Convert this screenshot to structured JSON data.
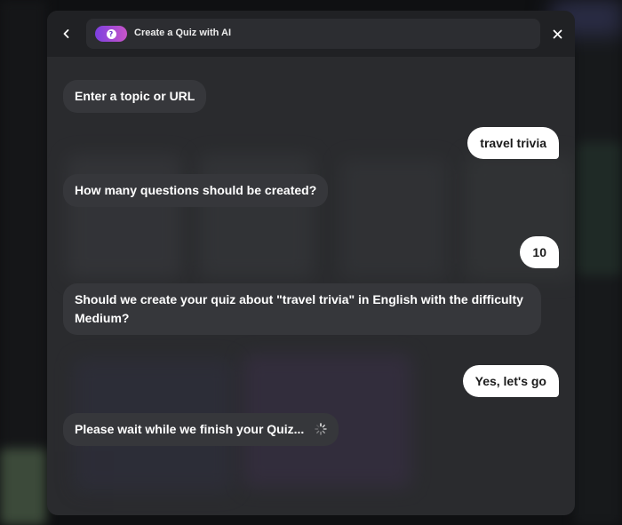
{
  "header": {
    "title": "Create a Quiz with AI",
    "back_icon": "chevron-left-icon",
    "badge_icon": "question-icon",
    "close_icon": "close-icon"
  },
  "messages": [
    {
      "role": "bot",
      "text": "Enter a topic or URL"
    },
    {
      "role": "user",
      "text": "travel trivia"
    },
    {
      "role": "bot",
      "text": "How many questions should be created?"
    },
    {
      "role": "user",
      "text": "10"
    },
    {
      "role": "bot",
      "text": "Should we create your quiz about \"travel trivia\" in English with the difficulty Medium?"
    },
    {
      "role": "user",
      "text": "Yes, let's go"
    },
    {
      "role": "bot",
      "text": "Please wait while we finish your Quiz...",
      "loading_icon": "spinner-icon"
    }
  ],
  "colors": {
    "modal_bg": "#2a2b2e",
    "header_bg": "#202124",
    "bot_bubble": "#36373b",
    "user_bubble": "#ffffff",
    "badge_gradient_start": "#7c3fe0",
    "badge_gradient_end": "#c855c9"
  }
}
